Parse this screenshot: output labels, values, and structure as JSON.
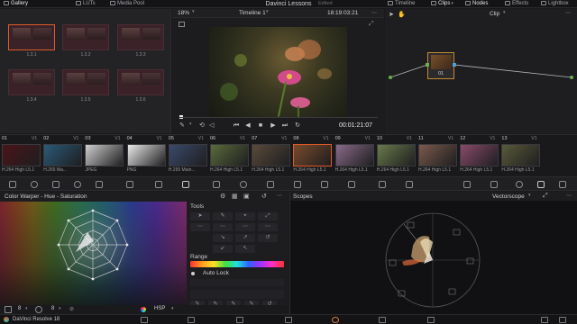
{
  "topbar": {
    "items": [
      {
        "label": "Gallery",
        "active": true
      },
      {
        "label": "LUTs",
        "active": false
      },
      {
        "label": "Media Pool",
        "active": false
      }
    ],
    "project_title": "Davinci Lessons",
    "edited": "Edited",
    "right_items": [
      {
        "label": "Timeline",
        "active": false
      },
      {
        "label": "Clips",
        "active": true
      },
      {
        "label": "Nodes",
        "active": true
      },
      {
        "label": "Effects",
        "active": false
      },
      {
        "label": "Lightbox",
        "active": false
      }
    ]
  },
  "gallery": {
    "stills": [
      "1.3.1",
      "1.3.2",
      "1.3.3",
      "1.3.4",
      "1.3.5",
      "1.3.6"
    ]
  },
  "viewer": {
    "zoom": "18%",
    "timeline_name": "Timeline 1",
    "source_timecode": "18:19:03:21",
    "current_timecode": "00:01:21:07"
  },
  "nodes": {
    "mode": "Clip",
    "node_label": "01"
  },
  "clips": [
    {
      "num": "01",
      "track": "V1",
      "codec": "H.264 High L5.1",
      "color": "#4a1418"
    },
    {
      "num": "02",
      "track": "V1",
      "codec": "H.265 Ma...",
      "color": "#2a5a7a"
    },
    {
      "num": "03",
      "track": "V1",
      "codec": "JPEG",
      "color": "#cfcfcf"
    },
    {
      "num": "04",
      "track": "V1",
      "codec": "PNG",
      "color": "#e8e8e8"
    },
    {
      "num": "05",
      "track": "V1",
      "codec": "H.265 Main...",
      "color": "#3a4a6a"
    },
    {
      "num": "06",
      "track": "V1",
      "codec": "H.264 High L5.1",
      "color": "#5a6a3a"
    },
    {
      "num": "07",
      "track": "V1",
      "codec": "H.264 High L5.1",
      "color": "#5a4a3a"
    },
    {
      "num": "08",
      "track": "V1",
      "codec": "H.264 High L5.1",
      "color": "#7a4a2a",
      "selected": true
    },
    {
      "num": "09",
      "track": "V1",
      "codec": "H.264 High L5.1",
      "color": "#8a6a8a"
    },
    {
      "num": "10",
      "track": "V1",
      "codec": "H.264 High L5.1",
      "color": "#6a7a4a"
    },
    {
      "num": "11",
      "track": "V1",
      "codec": "H.264 High L5.1",
      "color": "#7a5a4a"
    },
    {
      "num": "12",
      "track": "V1",
      "codec": "H.264 High L5.1",
      "color": "#8a4a6a"
    },
    {
      "num": "13",
      "track": "V1",
      "codec": "H.264 High L5.1",
      "color": "#5a5a3a"
    }
  ],
  "warper": {
    "title": "Color Warper - Hue - Saturation",
    "tools_label": "Tools",
    "range_label": "Range",
    "auto_lock": "Auto Lock",
    "mode": "HSP",
    "grid_count_a": "8",
    "grid_count_b": "8"
  },
  "scopes": {
    "title": "Scopes",
    "type": "Vectorscope"
  },
  "bottombar": {
    "app_name": "DaVinci Resolve 18"
  },
  "colors": {
    "accent": "#e05a2a",
    "node_border": "#c48a30"
  }
}
